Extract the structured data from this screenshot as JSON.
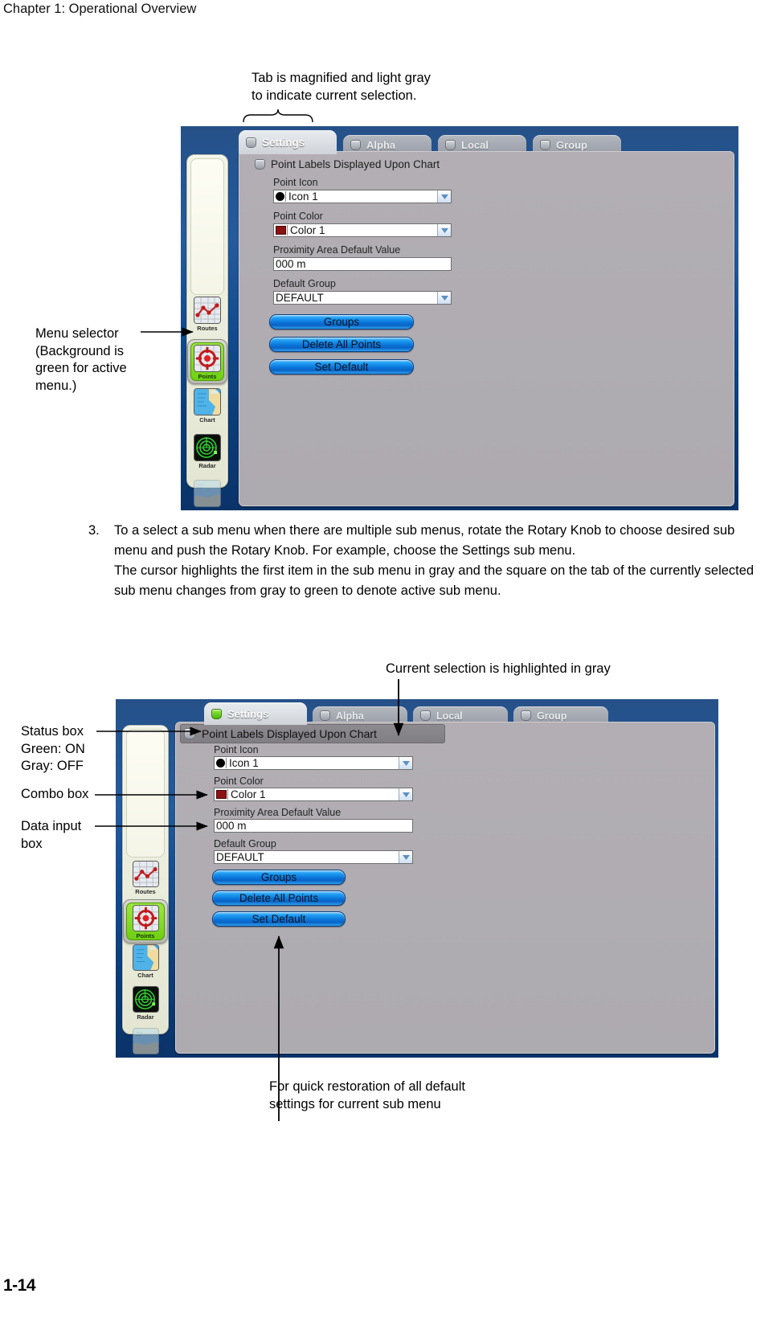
{
  "document": {
    "chapter_header": "Chapter 1: Operational Overview",
    "page_number": "1-14"
  },
  "annotations": {
    "tab_note": "Tab is magnified and light gray\nto indicate current selection.",
    "menu_selector": "Menu selector\n(Background is\ngreen for active\nmenu.)",
    "current_selection": "Current selection is highlighted in gray",
    "status_box": "Status box\nGreen: ON\nGray: OFF",
    "combo_box": "Combo box",
    "data_input_box": "Data input\nbox",
    "set_default_note": "For quick restoration of all default\nsettings for current sub menu"
  },
  "body": {
    "step_number": "3.",
    "paragraph_1": "To a select a sub menu when there are multiple sub menus, rotate the Rotary Knob to choose desired sub menu and push the Rotary Knob. For example, choose the Settings sub menu.",
    "paragraph_2": "The cursor highlights the first item in the sub menu in gray and the square on the tab of the currently selected sub menu changes from gray to green to denote active sub menu."
  },
  "panel": {
    "tabs": [
      {
        "label": "Settings",
        "active": true,
        "status": "gray"
      },
      {
        "label": "Alpha",
        "active": false,
        "status": "gray"
      },
      {
        "label": "Local",
        "active": false,
        "status": "gray"
      },
      {
        "label": "Group",
        "active": false,
        "status": "gray"
      }
    ],
    "tabs_2": [
      {
        "label": "Settings",
        "active": true,
        "status": "green"
      },
      {
        "label": "Alpha",
        "active": false,
        "status": "gray"
      },
      {
        "label": "Local",
        "active": false,
        "status": "gray"
      },
      {
        "label": "Group",
        "active": false,
        "status": "gray"
      }
    ],
    "section_title": "Point Labels Displayed Upon Chart",
    "fields": [
      {
        "label": "Point Icon",
        "value": "Icon 1",
        "type": "combo",
        "swatch": "circle",
        "swatch_color": "#000000"
      },
      {
        "label": "Point Color",
        "value": "Color 1",
        "type": "combo",
        "swatch": "square",
        "swatch_color": "#8b1113"
      },
      {
        "label": "Proximity Area Default Value",
        "value": "000 m",
        "type": "input",
        "swatch": "none"
      },
      {
        "label": "Default Group",
        "value": "DEFAULT",
        "type": "combo",
        "swatch": "none"
      }
    ],
    "buttons": [
      {
        "label": "Groups"
      },
      {
        "label": "Delete All Points"
      },
      {
        "label": "Set Default"
      }
    ],
    "rail_items": [
      {
        "label": "Routes",
        "icon": "routes-icon",
        "selected": false
      },
      {
        "label": "Points",
        "icon": "points-icon",
        "selected": true
      },
      {
        "label": "Chart",
        "icon": "chart-icon",
        "selected": false
      },
      {
        "label": "Radar",
        "icon": "radar-icon",
        "selected": false
      },
      {
        "label": "",
        "icon": "map-icon",
        "selected": false
      }
    ]
  },
  "colors": {
    "panel_blue": "#12488c",
    "pane_gray": "#b0acb2",
    "active_green": "#6fcf12",
    "button_blue": "#0a74da",
    "highlight_gray": "#8d8a90"
  }
}
